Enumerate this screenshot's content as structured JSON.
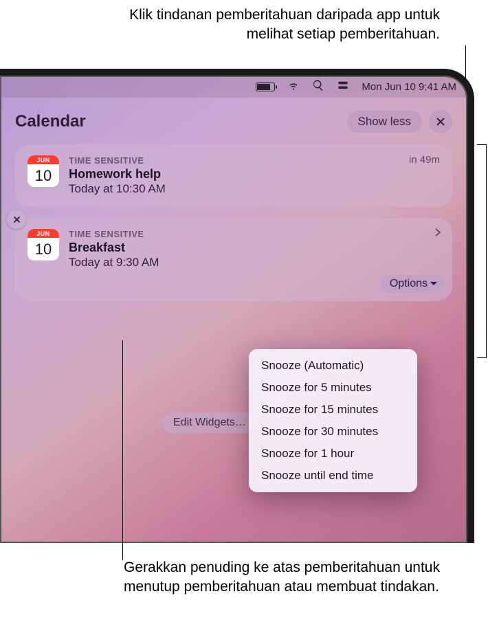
{
  "callouts": {
    "top": "Klik tindanan pemberitahuan daripada app untuk melihat setiap pemberitahuan.",
    "bottom": "Gerakkan penuding ke atas pemberitahuan untuk menutup pemberitahuan atau membuat tindakan."
  },
  "menubar": {
    "date_time": "Mon Jun 10  9:41 AM"
  },
  "notifications": {
    "app_title": "Calendar",
    "show_less": "Show less",
    "edit_widgets": "Edit Widgets…",
    "items": [
      {
        "icon_month": "JUN",
        "icon_day": "10",
        "badge": "TIME SENSITIVE",
        "title": "Homework help",
        "subtitle": "Today at 10:30 AM",
        "time": "in 49m"
      },
      {
        "icon_month": "JUN",
        "icon_day": "10",
        "badge": "TIME SENSITIVE",
        "title": "Breakfast",
        "subtitle": "Today at 9:30 AM",
        "options_label": "Options"
      }
    ]
  },
  "options_menu": {
    "items": [
      "Snooze (Automatic)",
      "Snooze for 5 minutes",
      "Snooze for 15 minutes",
      "Snooze for 30 minutes",
      "Snooze for 1 hour",
      "Snooze until end time"
    ]
  }
}
